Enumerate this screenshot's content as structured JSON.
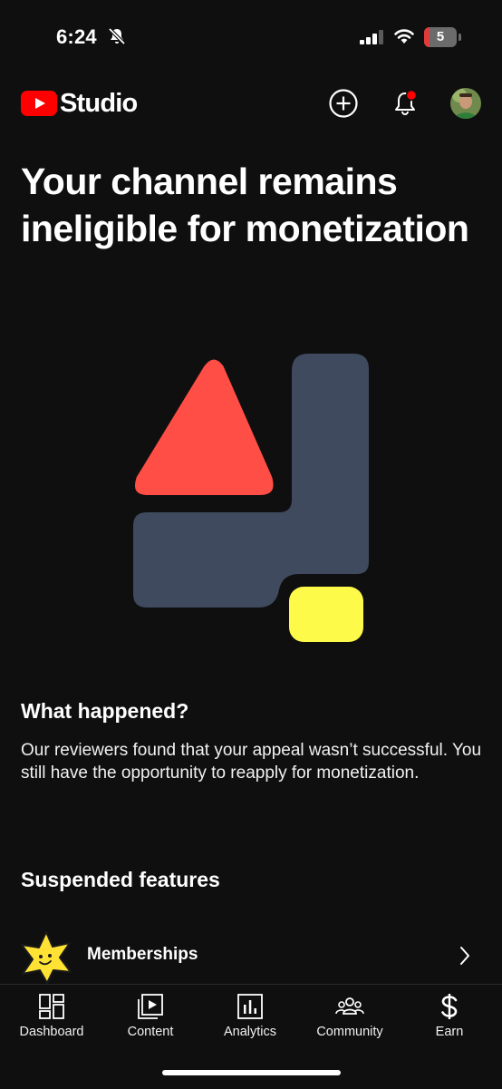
{
  "status_bar": {
    "time": "6:24",
    "battery": "5",
    "icons": [
      "bell-off-icon",
      "cellular-signal-icon",
      "wifi-icon",
      "battery-icon"
    ]
  },
  "header": {
    "logo_text": "Studio",
    "icons": [
      "youtube-play-logo",
      "create-plus-icon",
      "notifications-bell-icon",
      "avatar"
    ],
    "brand_color": "#ff0000",
    "notification_dot_color": "#ff0000"
  },
  "page": {
    "title": "Your channel remains ineligible for monetization"
  },
  "illustration": {
    "colors": {
      "triangle": "#ff4e45",
      "block": "#3f4a5e",
      "square": "#fdfa4a"
    }
  },
  "what_happened": {
    "heading": "What happened?",
    "body": "Our reviewers found that your appeal wasn’t successful. You still have the opportunity to reapply for monetization."
  },
  "suspended": {
    "heading": "Suspended features",
    "items": [
      {
        "label": "Memberships",
        "icon": "star-mascot-icon"
      }
    ]
  },
  "bottom_nav": {
    "items": [
      {
        "label": "Dashboard",
        "icon": "dashboard-icon"
      },
      {
        "label": "Content",
        "icon": "content-icon"
      },
      {
        "label": "Analytics",
        "icon": "analytics-icon"
      },
      {
        "label": "Community",
        "icon": "community-icon"
      },
      {
        "label": "Earn",
        "icon": "dollar-icon"
      }
    ]
  }
}
